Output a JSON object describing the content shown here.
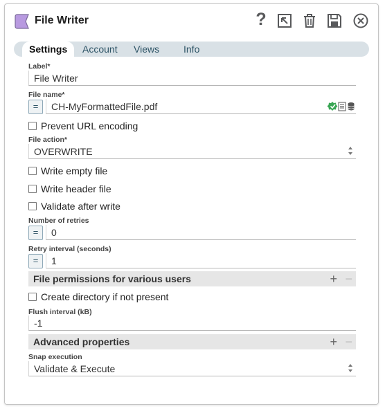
{
  "header": {
    "title": "File Writer",
    "help_glyph": "?",
    "icons": [
      "snap-icon",
      "help-icon",
      "export-icon",
      "trash-icon",
      "save-icon",
      "close-icon"
    ]
  },
  "tabs": [
    {
      "label": "Settings",
      "active": true
    },
    {
      "label": "Account",
      "active": false
    },
    {
      "label": "Views",
      "active": false
    },
    {
      "label": "Info",
      "active": false
    }
  ],
  "form": {
    "label_label": "Label*",
    "label_value": "File Writer",
    "filename_label": "File name*",
    "filename_value": "CH-MyFormattedFile.pdf",
    "eq_glyph": "=",
    "prevent_url_encoding": "Prevent URL encoding",
    "file_action_label": "File action*",
    "file_action_value": "OVERWRITE",
    "write_empty_file": "Write empty file",
    "write_header_file": "Write header file",
    "validate_after_write": "Validate after write",
    "retries_label": "Number of retries",
    "retries_value": "0",
    "retry_interval_label": "Retry interval (seconds)",
    "retry_interval_value": "1",
    "file_permissions_section": "File permissions for various users",
    "create_directory": "Create directory if not present",
    "flush_interval_label": "Flush interval (kB)",
    "flush_interval_value": "-1",
    "advanced_section": "Advanced properties",
    "snap_execution_label": "Snap execution",
    "snap_execution_value": "Validate & Execute",
    "plus_glyph": "+",
    "minus_glyph": "−"
  },
  "colors": {
    "snap_accent": "#b89ae0",
    "tab_bar": "#d9e1e6",
    "valid_green": "#3aa655"
  }
}
